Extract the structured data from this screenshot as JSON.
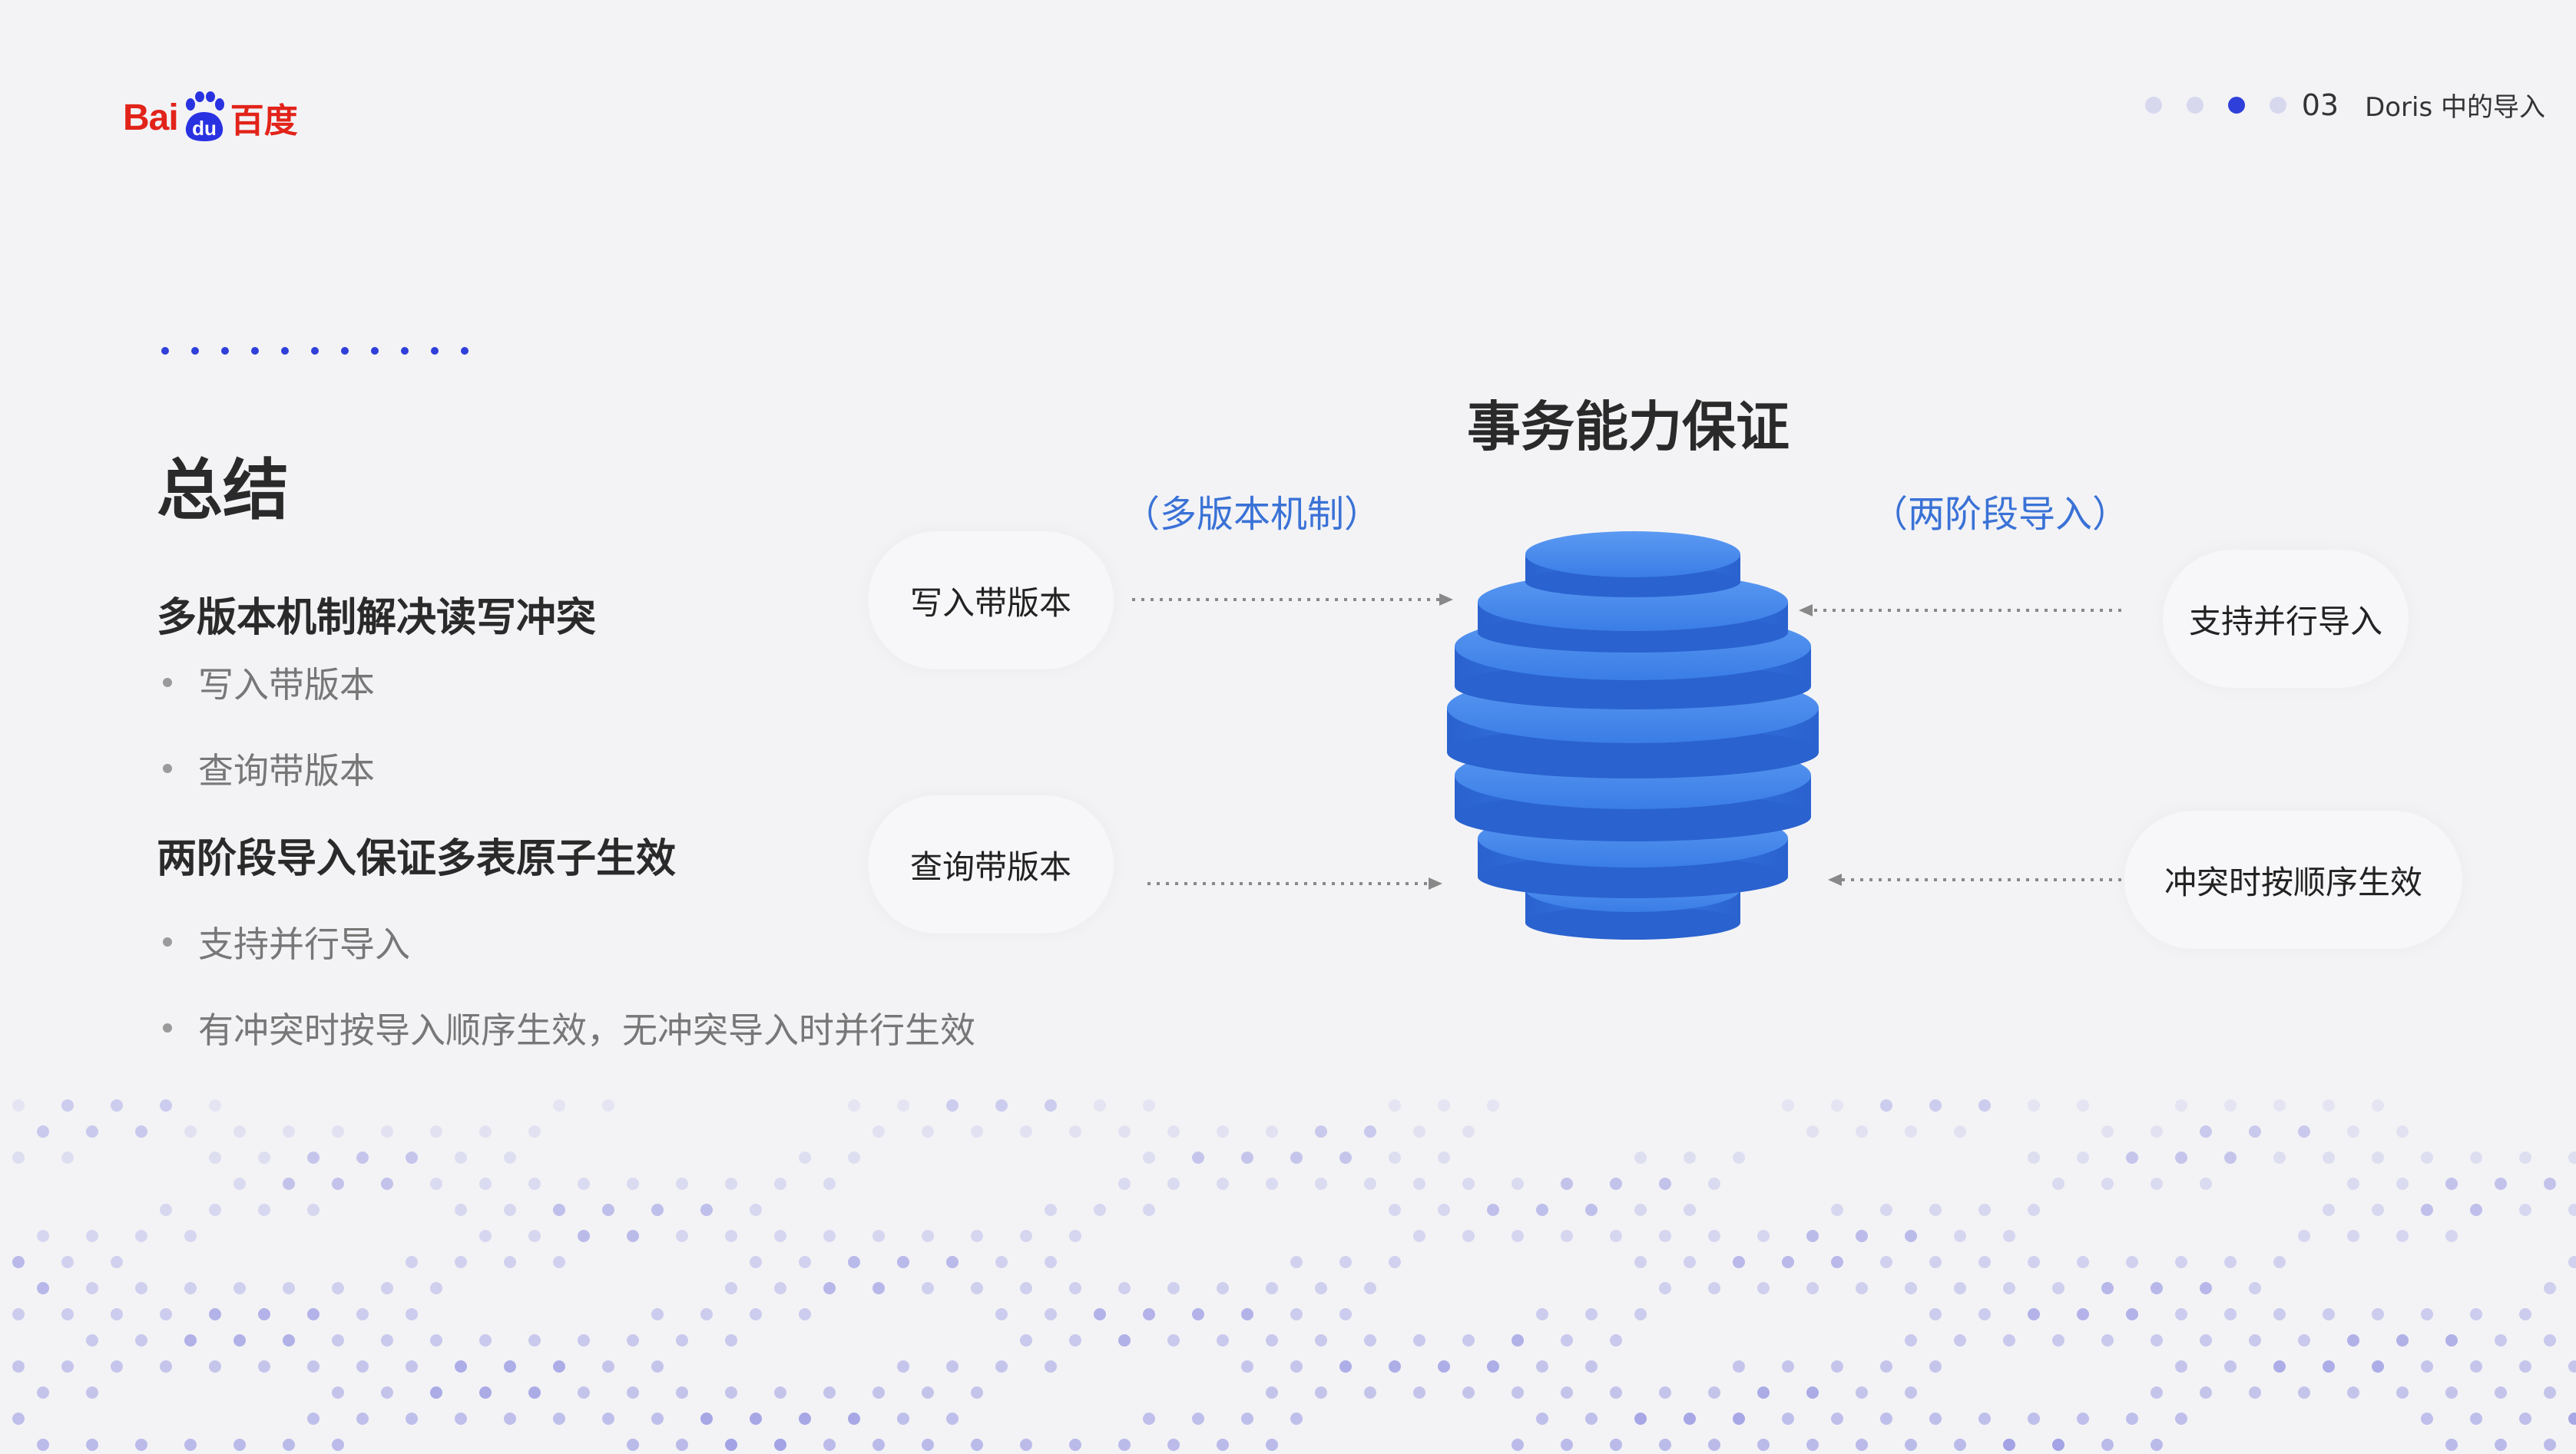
{
  "header": {
    "logo_prefix": "Bai",
    "logo_middle": "du",
    "logo_cn": "百度",
    "page_number": "03",
    "section_title": "Doris 中的导入",
    "progress": {
      "total": 4,
      "current": 3
    }
  },
  "content": {
    "title": "总结",
    "groups": [
      {
        "heading": "多版本机制解决读写冲突",
        "bullets": [
          "写入带版本",
          "查询带版本"
        ]
      },
      {
        "heading": "两阶段导入保证多表原子生效",
        "bullets": [
          "支持并行导入",
          "有冲突时按导入顺序生效，无冲突导入时并行生效"
        ]
      }
    ]
  },
  "diagram": {
    "title": "事务能力保证",
    "left_caption": "（多版本机制）",
    "right_caption": "（两阶段导入）",
    "left_nodes": [
      "写入带版本",
      "查询带版本"
    ],
    "right_nodes": [
      "支持并行导入",
      "冲突时按顺序生效"
    ]
  },
  "colors": {
    "accent": "#2f3fd9",
    "brand": "#e2231a",
    "disk": "#3a7de6",
    "caption": "#3a72d6"
  }
}
